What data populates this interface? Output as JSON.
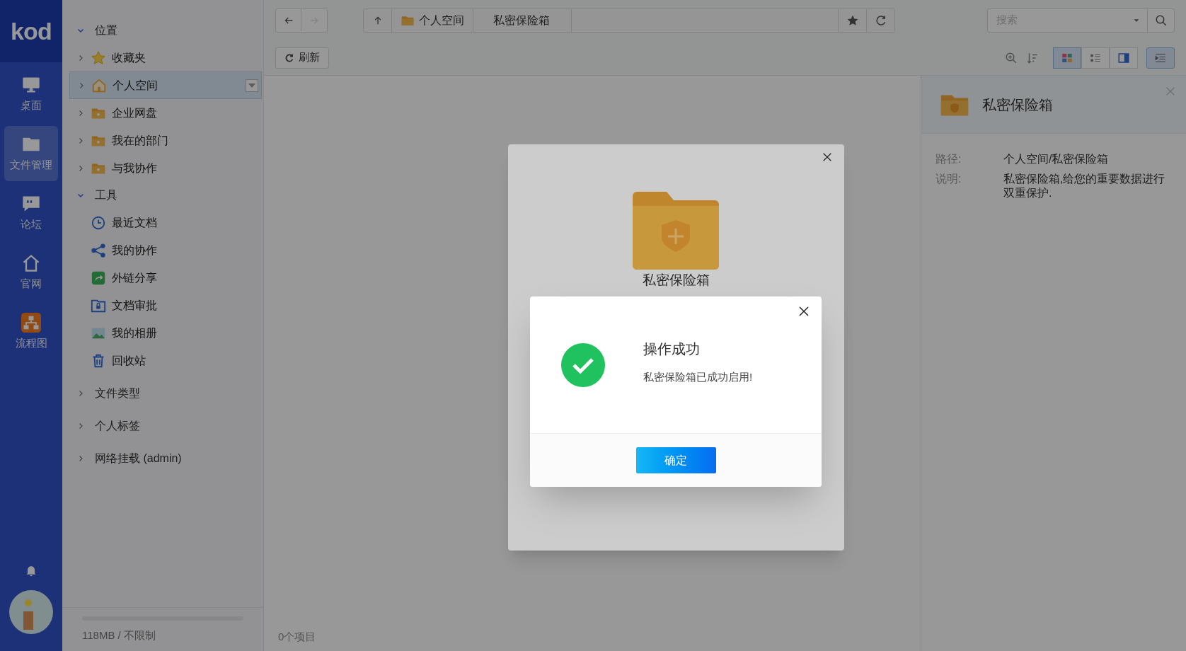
{
  "app": {
    "logo": "kod"
  },
  "nav": [
    {
      "label": "桌面",
      "kind": "monitor",
      "selected": false
    },
    {
      "label": "文件管理",
      "kind": "folder",
      "selected": true
    },
    {
      "label": "论坛",
      "kind": "chat",
      "selected": false
    },
    {
      "label": "官网",
      "kind": "home",
      "selected": false
    },
    {
      "label": "流程图",
      "kind": "flow",
      "selected": false
    }
  ],
  "tree": [
    {
      "label": "位置",
      "expanded": true,
      "children": [
        {
          "label": "收藏夹",
          "kind": "star",
          "selected": false
        },
        {
          "label": "个人空间",
          "kind": "home",
          "selected": true
        },
        {
          "label": "企业网盘",
          "kind": "folder",
          "selected": false
        },
        {
          "label": "我在的部门",
          "kind": "folder",
          "selected": false
        },
        {
          "label": "与我协作",
          "kind": "folder",
          "selected": false
        }
      ]
    },
    {
      "label": "工具",
      "expanded": true,
      "children": [
        {
          "label": "最近文档",
          "kind": "clock",
          "selected": false
        },
        {
          "label": "我的协作",
          "kind": "share",
          "selected": false
        },
        {
          "label": "外链分享",
          "kind": "link",
          "selected": false
        },
        {
          "label": "文档审批",
          "kind": "approval",
          "selected": false
        },
        {
          "label": "我的相册",
          "kind": "photo",
          "selected": false
        },
        {
          "label": "回收站",
          "kind": "trash",
          "selected": false
        }
      ]
    },
    {
      "label": "文件类型",
      "expanded": false
    },
    {
      "label": "个人标签",
      "expanded": false
    },
    {
      "label": "网络挂载 (admin)",
      "expanded": false
    }
  ],
  "storage": {
    "text": "118MB / 不限制"
  },
  "toolbar": {
    "forward_disabled": true,
    "breadcrumbs": [
      "个人空间",
      "私密保险箱"
    ],
    "search": {
      "placeholder": "搜索"
    },
    "refresh": "刷新",
    "views": [
      {
        "kind": "grid",
        "selected": true
      },
      {
        "kind": "list",
        "selected": false
      },
      {
        "kind": "split",
        "selected": false
      }
    ],
    "info_panel_on": true
  },
  "status_bar": {
    "count": "0个项目"
  },
  "info_panel": {
    "title": "私密保险箱",
    "fields": [
      {
        "label": "路径:",
        "value": "个人空间/私密保险箱"
      },
      {
        "label": "说明:",
        "value": "私密保险箱,给您的重要数据进行双重保护."
      }
    ]
  },
  "vault_dialog": {
    "title": "私密保险箱"
  },
  "alert": {
    "title": "操作成功",
    "message": "私密保险箱已成功启用!",
    "button": "确定"
  }
}
